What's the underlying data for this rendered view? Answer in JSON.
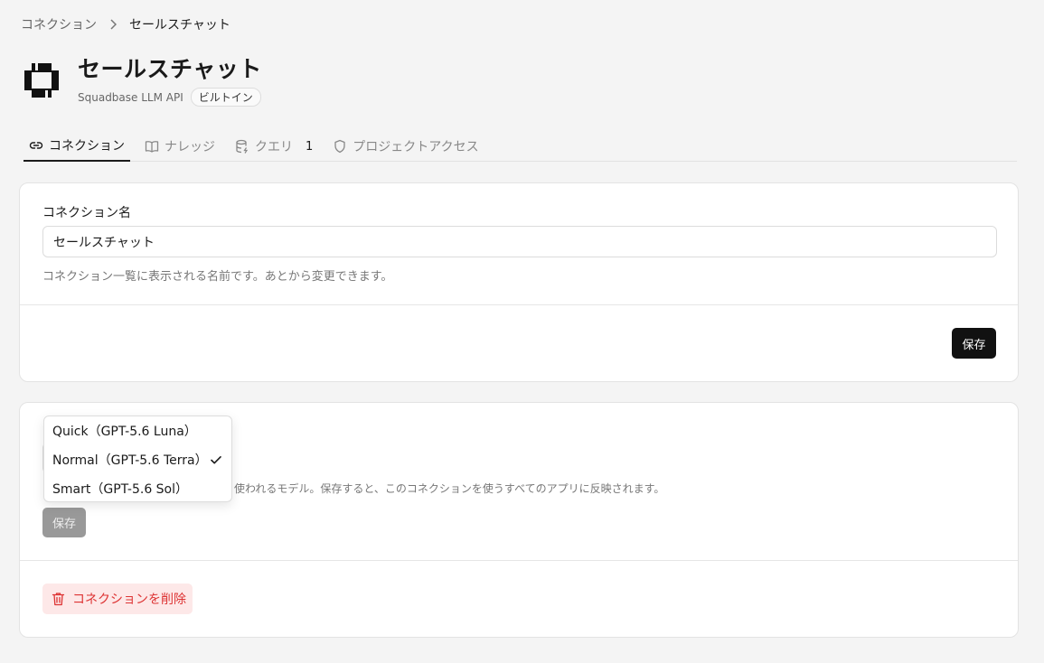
{
  "breadcrumb": {
    "parent": "コネクション",
    "current": "セールスチャット"
  },
  "header": {
    "title": "セールスチャット",
    "provider": "Squadbase LLM API",
    "badge": "ビルトイン"
  },
  "tabs": [
    {
      "label": "コネクション",
      "icon": "link-icon",
      "active": true
    },
    {
      "label": "ナレッジ",
      "icon": "book-icon",
      "active": false
    },
    {
      "label": "クエリ",
      "icon": "database-icon",
      "active": false,
      "count": "1"
    },
    {
      "label": "プロジェクトアクセス",
      "icon": "shield-icon",
      "active": false
    }
  ],
  "name_card": {
    "label": "コネクション名",
    "value": "セールスチャット",
    "help": "コネクション一覧に表示される名前です。あとから変更できます。",
    "save_label": "保存"
  },
  "model_card": {
    "help_partial": "使われるモデル。保存すると、このコネクションを使うすべてのアプリに反映されます。",
    "save_label": "保存",
    "delete_label": "コネクションを削除"
  },
  "model_options": [
    {
      "label": "Quick（GPT-5.6 Luna）",
      "selected": false
    },
    {
      "label": "Normal（GPT-5.6 Terra）",
      "selected": true
    },
    {
      "label": "Smart（GPT-5.6 Sol）",
      "selected": false
    }
  ],
  "colors": {
    "primary": "#111111",
    "danger": "#dd3333",
    "danger_bg": "#fde8e8"
  }
}
